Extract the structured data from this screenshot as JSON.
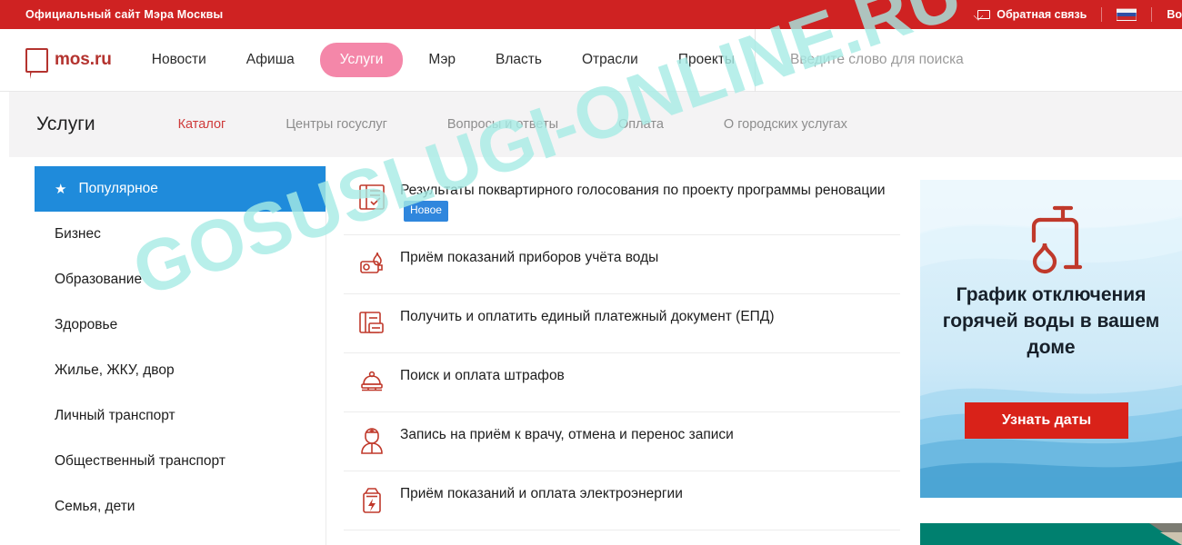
{
  "topbar": {
    "title": "Официальный сайт Мэра Москвы",
    "feedback_label": "Обратная связь",
    "feedback_icon": "envelope-icon",
    "flag_icon": "russian-flag-icon",
    "login_label": "Во"
  },
  "navbar": {
    "logo_text": "mos.ru",
    "logo_icon": "mos-speech-bubble-logo",
    "links": [
      {
        "label": "Новости",
        "active": false
      },
      {
        "label": "Афиша",
        "active": false
      },
      {
        "label": "Услуги",
        "active": true
      },
      {
        "label": "Мэр",
        "active": false
      },
      {
        "label": "Власть",
        "active": false
      },
      {
        "label": "Отрасли",
        "active": false
      },
      {
        "label": "Проекты",
        "active": false
      }
    ],
    "search": {
      "placeholder": "Введите слово для поиска",
      "value": ""
    }
  },
  "subbar": {
    "title": "Услуги",
    "tabs": [
      {
        "label": "Каталог",
        "active": true
      },
      {
        "label": "Центры госуслуг",
        "active": false
      },
      {
        "label": "Вопросы и ответы",
        "active": false
      },
      {
        "label": "Оплата",
        "active": false
      },
      {
        "label": "О городских услугах",
        "active": false
      }
    ]
  },
  "sidebar": {
    "items": [
      {
        "label": "Популярное",
        "active": true,
        "icon": "star-icon"
      },
      {
        "label": "Бизнес",
        "active": false
      },
      {
        "label": "Образование",
        "active": false
      },
      {
        "label": "Здоровье",
        "active": false
      },
      {
        "label": "Жилье, ЖКУ, двор",
        "active": false
      },
      {
        "label": "Личный транспорт",
        "active": false
      },
      {
        "label": "Общественный транспорт",
        "active": false
      },
      {
        "label": "Семья, дети",
        "active": false
      }
    ]
  },
  "services": [
    {
      "label": "Результаты поквартирного голосования по проекту программы реновации",
      "badge": "Новое",
      "icon": "clipboard-checklist-icon"
    },
    {
      "label": "Приём показаний приборов учёта воды",
      "badge": "",
      "icon": "water-meter-icon"
    },
    {
      "label": "Получить и оплатить единый платежный документ (ЕПД)",
      "badge": "",
      "icon": "payment-document-icon"
    },
    {
      "label": "Поиск и оплата штрафов",
      "badge": "",
      "icon": "police-cap-icon"
    },
    {
      "label": "Запись на приём к врачу, отмена и перенос записи",
      "badge": "",
      "icon": "doctor-icon"
    },
    {
      "label": "Приём показаний и оплата электроэнергии",
      "badge": "",
      "icon": "electricity-meter-icon"
    }
  ],
  "promo": {
    "icon": "water-tap-icon",
    "title": "График отключения горячей воды в вашем доме",
    "button_label": "Узнать даты"
  },
  "watermark": {
    "text": "GOSUSLUGI-ONLINE.RU"
  },
  "colors": {
    "brand_red": "#cf2222",
    "logo_red": "#b4332f",
    "accent_pink": "#f487a9",
    "active_blue": "#1f8bdb",
    "badge_blue": "#2f86dd",
    "tab_active_red": "#cf3b3b",
    "promo_button_red": "#d92219",
    "promo2_teal": "#00806f",
    "watermark_cyan": "#a7ece6",
    "icon_red": "#c0392b"
  }
}
